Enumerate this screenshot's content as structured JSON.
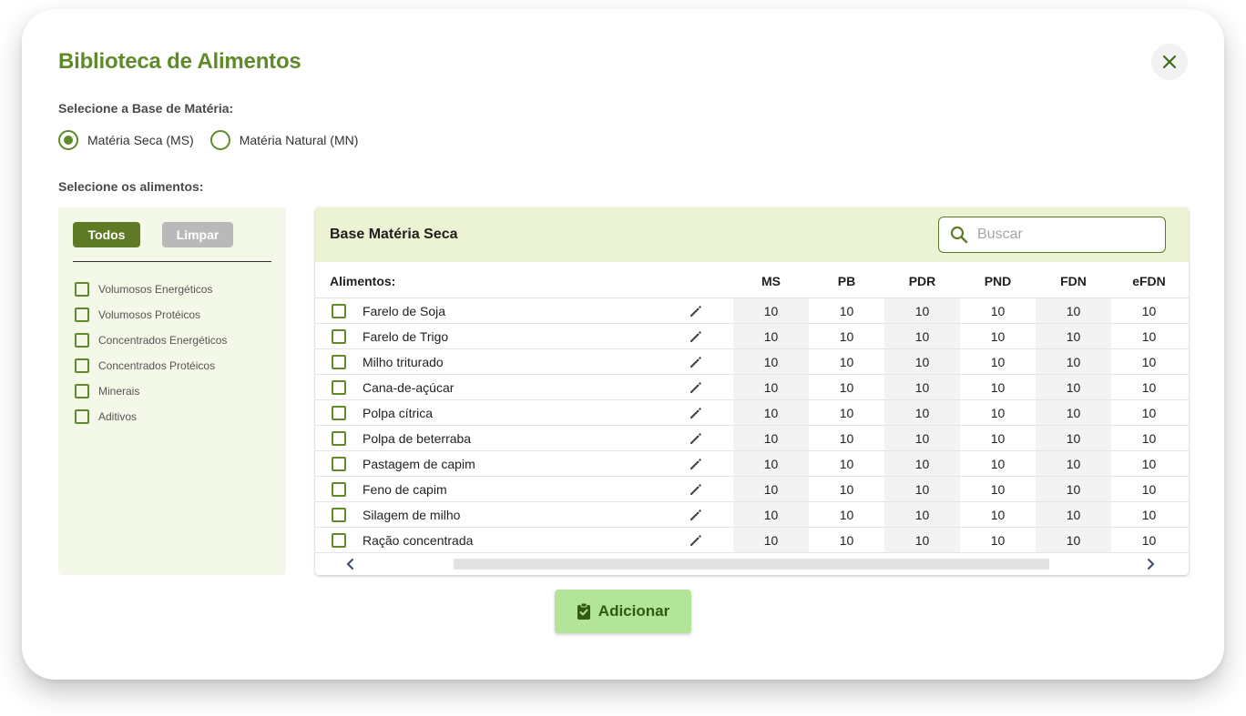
{
  "modal": {
    "title": "Biblioteca de Alimentos",
    "close_icon": "close-icon"
  },
  "base": {
    "label": "Selecione a Base de Matéria:",
    "options": [
      {
        "label": "Matéria Seca (MS)",
        "selected": true
      },
      {
        "label": "Matéria Natural (MN)",
        "selected": false
      }
    ]
  },
  "foods_label": "Selecione os alimentos:",
  "filters": {
    "all_label": "Todos",
    "clear_label": "Limpar",
    "categories": [
      {
        "label": "Volumosos Energéticos",
        "checked": false
      },
      {
        "label": "Volumosos Protéicos",
        "checked": false
      },
      {
        "label": "Concentrados Energéticos",
        "checked": false
      },
      {
        "label": "Concentrados Protéicos",
        "checked": false
      },
      {
        "label": "Minerais",
        "checked": false
      },
      {
        "label": "Aditivos",
        "checked": false
      }
    ]
  },
  "table": {
    "title": "Base Matéria Seca",
    "search_placeholder": "Buscar",
    "name_header": "Alimentos:",
    "columns": [
      "MS",
      "PB",
      "PDR",
      "PND",
      "FDN",
      "eFDN"
    ],
    "rows": [
      {
        "name": "Farelo de Soja",
        "values": [
          "10",
          "10",
          "10",
          "10",
          "10",
          "10"
        ]
      },
      {
        "name": "Farelo de Trigo",
        "values": [
          "10",
          "10",
          "10",
          "10",
          "10",
          "10"
        ]
      },
      {
        "name": "Milho triturado",
        "values": [
          "10",
          "10",
          "10",
          "10",
          "10",
          "10"
        ]
      },
      {
        "name": "Cana-de-açúcar",
        "values": [
          "10",
          "10",
          "10",
          "10",
          "10",
          "10"
        ]
      },
      {
        "name": "Polpa cítrica",
        "values": [
          "10",
          "10",
          "10",
          "10",
          "10",
          "10"
        ]
      },
      {
        "name": "Polpa de beterraba",
        "values": [
          "10",
          "10",
          "10",
          "10",
          "10",
          "10"
        ]
      },
      {
        "name": "Pastagem de capim",
        "values": [
          "10",
          "10",
          "10",
          "10",
          "10",
          "10"
        ]
      },
      {
        "name": "Feno de capim",
        "values": [
          "10",
          "10",
          "10",
          "10",
          "10",
          "10"
        ]
      },
      {
        "name": "Silagem de milho",
        "values": [
          "10",
          "10",
          "10",
          "10",
          "10",
          "10"
        ]
      },
      {
        "name": "Ração concentrada",
        "values": [
          "10",
          "10",
          "10",
          "10",
          "10",
          "10"
        ]
      }
    ]
  },
  "add_button": {
    "label": "Adicionar",
    "icon": "clipboard-check-icon"
  },
  "colors": {
    "brand_green": "#5f8a2a",
    "dark_green": "#5f7a24",
    "panel_bg": "#f4f8e9",
    "header_bg": "#ecf3d4",
    "add_bg": "#b2e59a"
  }
}
